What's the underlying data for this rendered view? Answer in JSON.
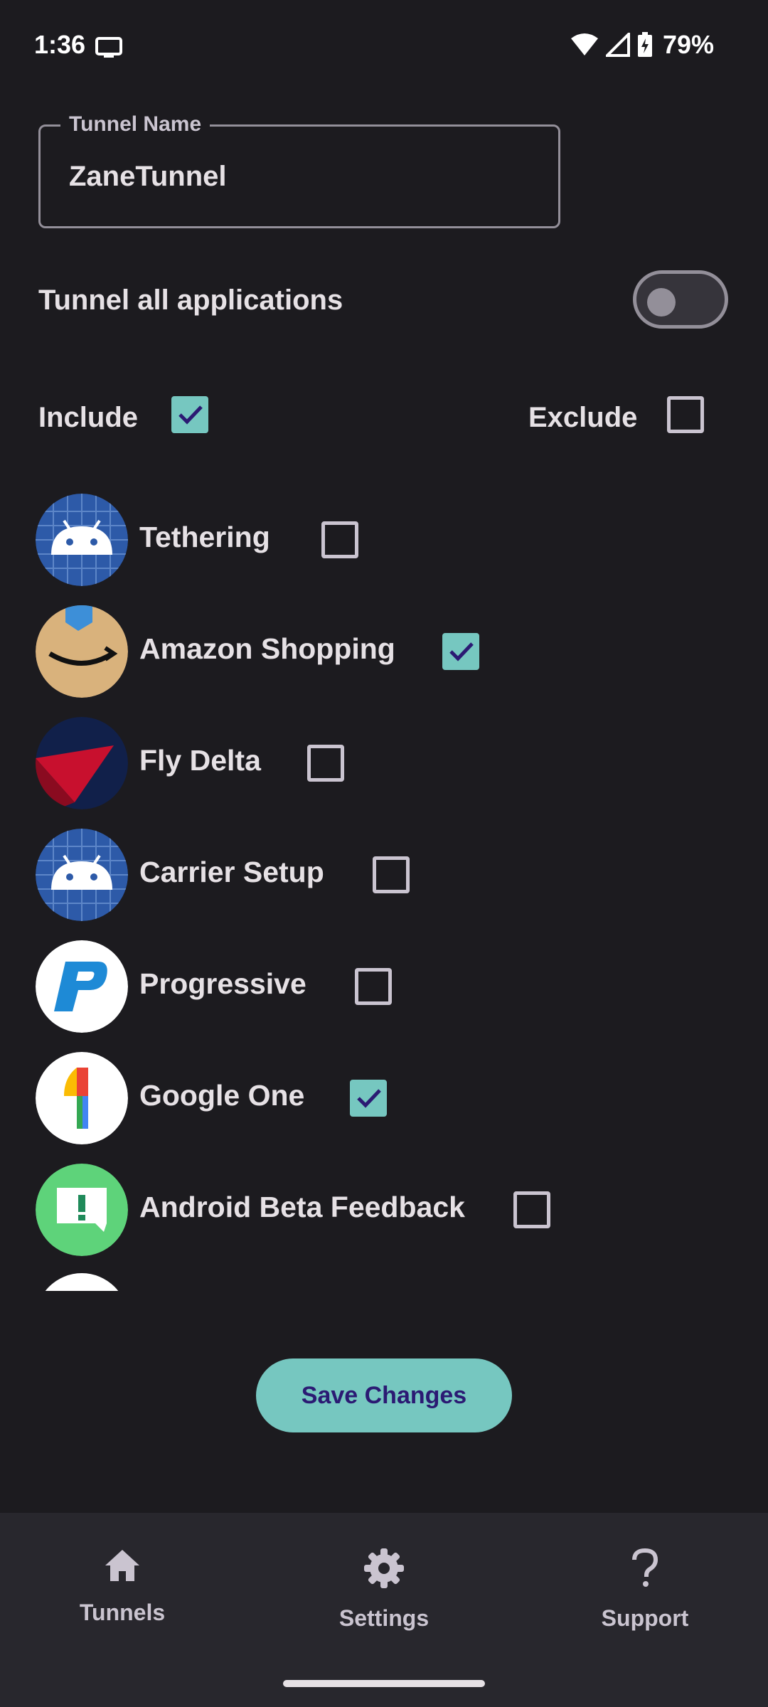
{
  "status_bar": {
    "time": "1:36",
    "battery": "79%"
  },
  "form": {
    "tunnel_name_label": "Tunnel Name",
    "tunnel_name_value": "ZaneTunnel",
    "tunnel_all_label": "Tunnel all applications",
    "tunnel_all_enabled": false,
    "include_label": "Include",
    "include_checked": true,
    "exclude_label": "Exclude",
    "exclude_checked": false
  },
  "apps": [
    {
      "name": "Tethering",
      "checked": false,
      "icon": "android-icon"
    },
    {
      "name": "Amazon Shopping",
      "checked": true,
      "icon": "amazon-icon"
    },
    {
      "name": "Fly Delta",
      "checked": false,
      "icon": "delta-icon"
    },
    {
      "name": "Carrier Setup",
      "checked": false,
      "icon": "android-icon"
    },
    {
      "name": "Progressive",
      "checked": false,
      "icon": "progressive-icon"
    },
    {
      "name": "Google One",
      "checked": true,
      "icon": "google-one-icon"
    },
    {
      "name": "Android Beta Feedback",
      "checked": false,
      "icon": "feedback-icon"
    }
  ],
  "save_button_label": "Save Changes",
  "nav": {
    "items": [
      {
        "label": "Tunnels",
        "icon": "home-icon"
      },
      {
        "label": "Settings",
        "icon": "gear-icon"
      },
      {
        "label": "Support",
        "icon": "question-icon"
      }
    ]
  },
  "colors": {
    "accent": "#76c7c0",
    "background": "#1c1b1f",
    "nav_background": "#28272d",
    "button_text": "#2b1a73"
  }
}
